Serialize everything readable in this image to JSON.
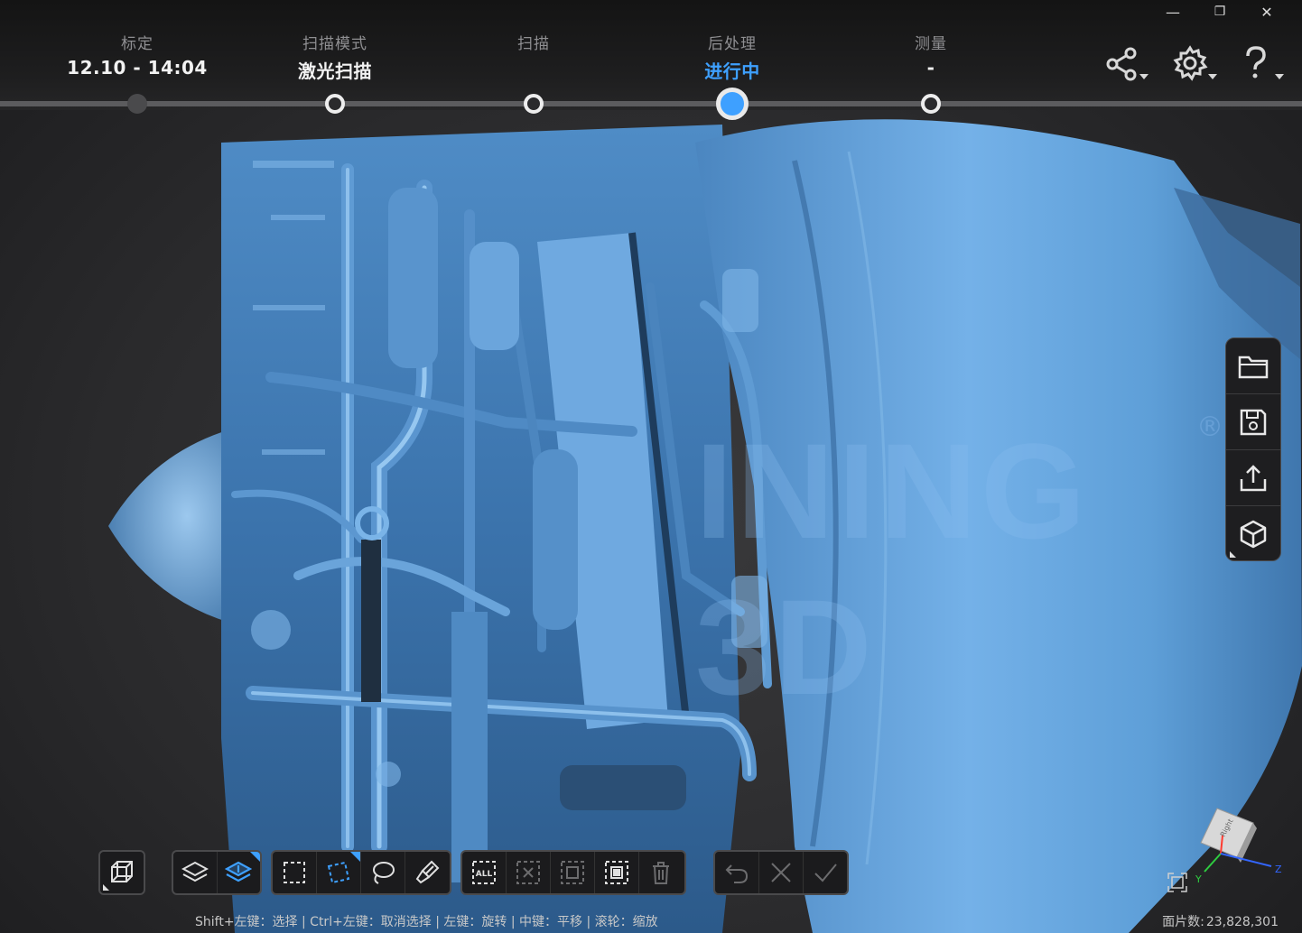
{
  "window": {
    "minimize_icon": "minimize-icon",
    "restore_icon": "restore-icon",
    "close_icon": "close-icon",
    "minimize_glyph": "—",
    "restore_glyph": "❐",
    "close_glyph": "✕"
  },
  "workflow": {
    "steps": [
      {
        "name": "标定",
        "value": "12.10 - 14:04",
        "state": "done"
      },
      {
        "name": "扫描模式",
        "value": "激光扫描",
        "state": "ring"
      },
      {
        "name": "扫描",
        "value": "",
        "state": "ring"
      },
      {
        "name": "后处理",
        "value": "进行中",
        "state": "current"
      },
      {
        "name": "测量",
        "value": "-",
        "state": "ring"
      }
    ]
  },
  "header_tools": [
    "share-icon",
    "settings-icon",
    "help-icon"
  ],
  "viewport": {
    "watermark": "INING 3D",
    "watermark_mark": "®",
    "scan_color": "#5e9fd8"
  },
  "side_panel": [
    "open-folder-icon",
    "save-icon",
    "export-icon",
    "model-cube-icon"
  ],
  "toolbar": {
    "groups": [
      [
        "wireframe-view-icon"
      ],
      [
        "layer-icon",
        "layer-active-icon"
      ],
      [
        "rect-select-icon",
        "polygon-select-icon",
        "lasso-select-icon",
        "brush-select-icon"
      ],
      [
        "select-all-icon",
        "deselect-icon",
        "invert-select-icon",
        "select-connected-icon",
        "delete-icon"
      ],
      [
        "undo-icon",
        "cancel-icon",
        "confirm-icon"
      ]
    ],
    "select_all_text": "ALL"
  },
  "status": {
    "hint": "Shift+左键：选择 | Ctrl+左键：取消选择 | 左键：旋转 | 中键：平移 | 滚轮：缩放",
    "count_label": "面片数:",
    "count_value": "23,828,301"
  },
  "view_cube": {
    "label": "Right",
    "axis_y": "Y",
    "axis_z": "Z"
  },
  "colors": {
    "accent": "#3ea0ff",
    "panel": "#1e1e20",
    "scan": "#5e9fd8"
  }
}
